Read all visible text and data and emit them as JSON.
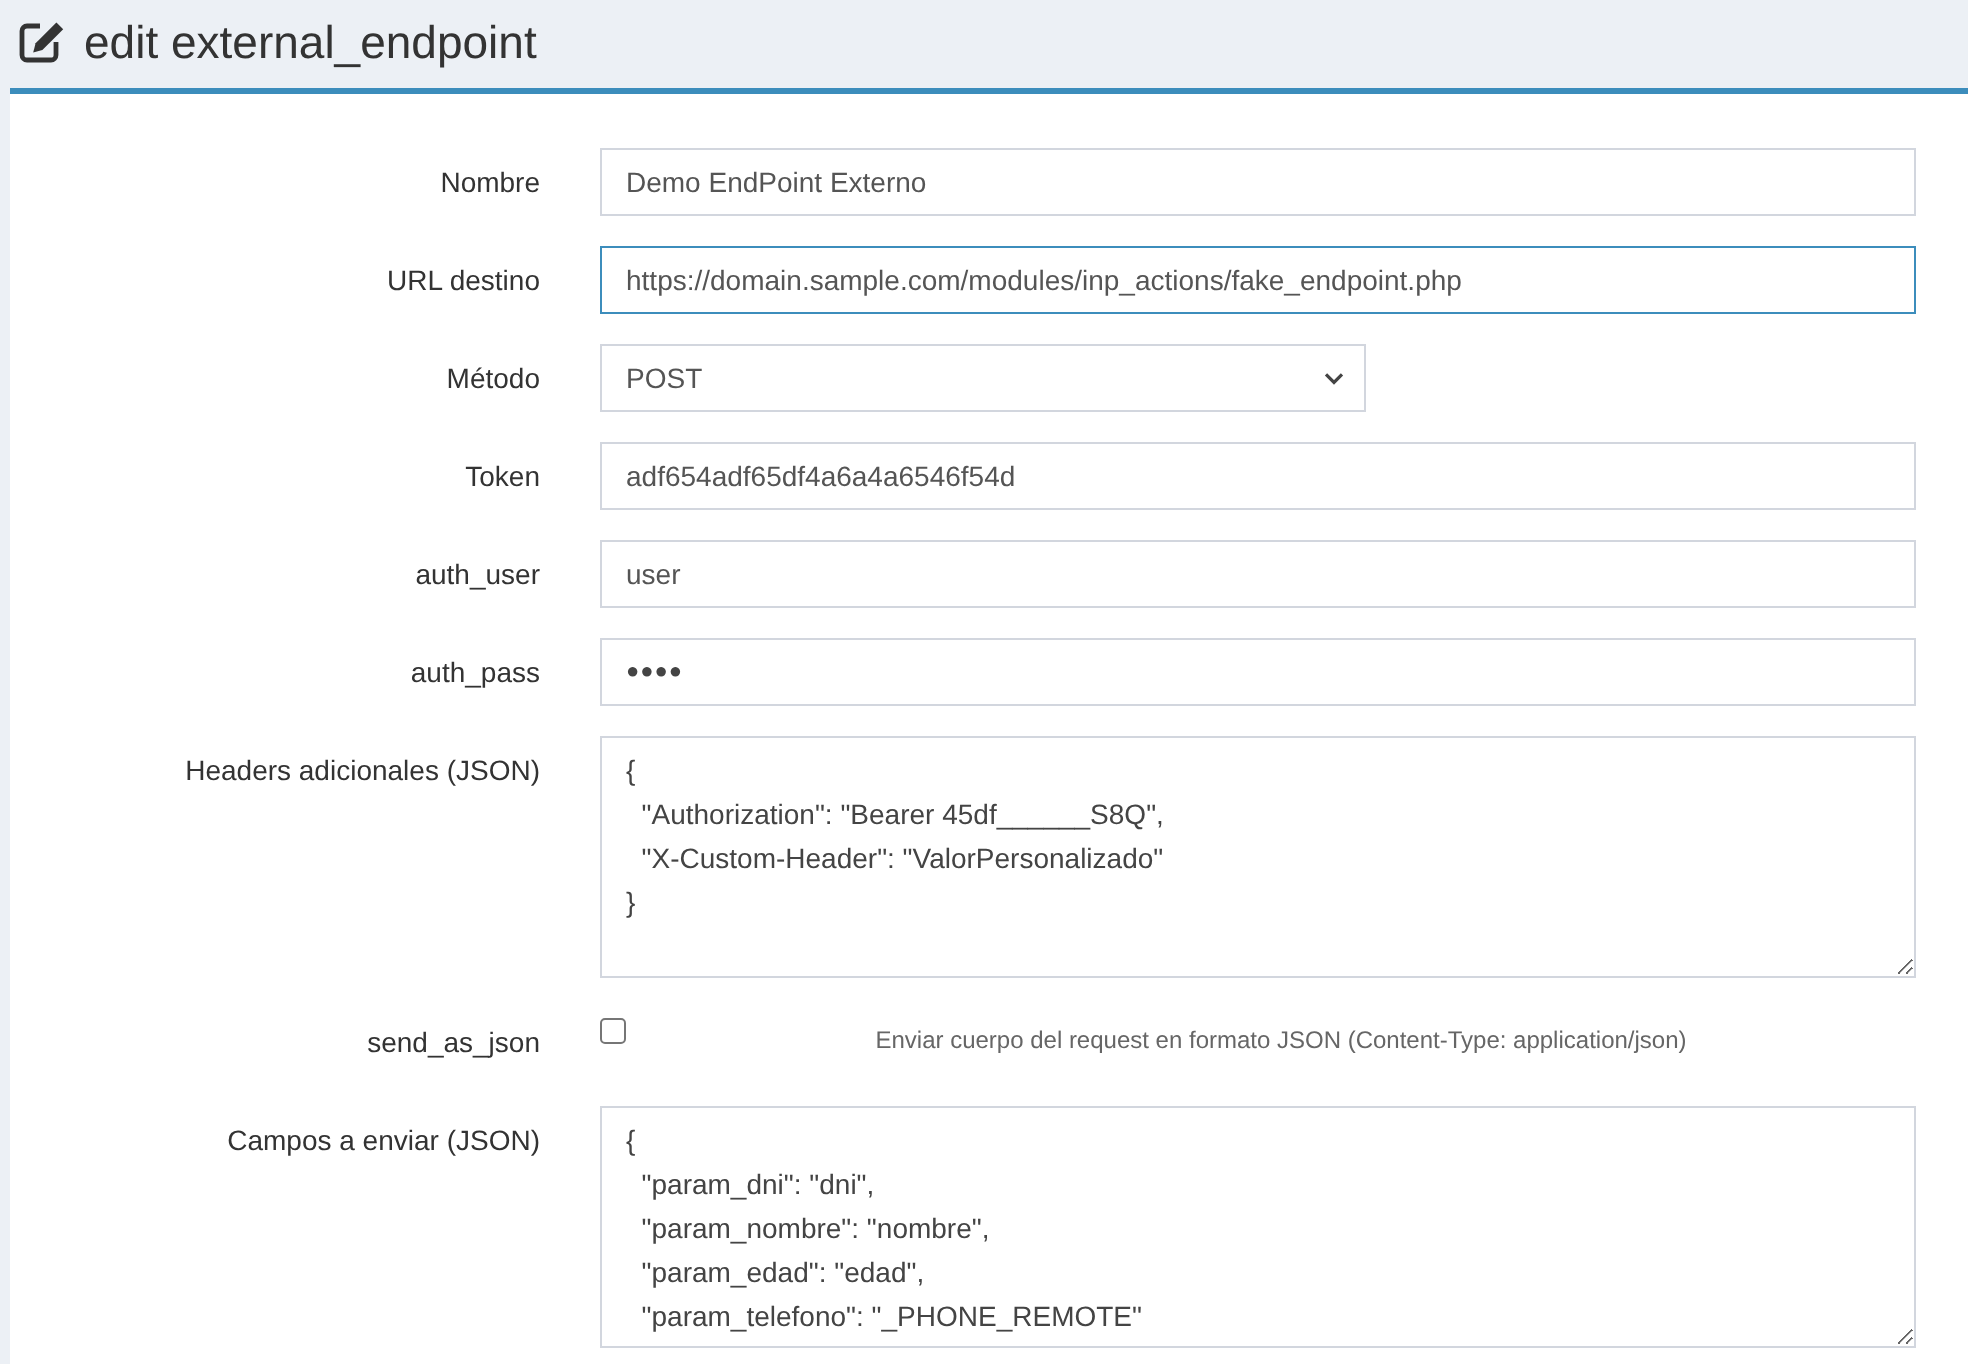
{
  "page": {
    "title": "edit external_endpoint"
  },
  "form": {
    "fields": [
      {
        "kind": "text",
        "label": "Nombre",
        "value": "Demo EndPoint Externo",
        "focused": false
      },
      {
        "kind": "text",
        "label": "URL destino",
        "value": "https://domain.sample.com/modules/inp_actions/fake_endpoint.php",
        "focused": true
      },
      {
        "kind": "select",
        "label": "Método",
        "value": "POST",
        "focused": false
      },
      {
        "kind": "text",
        "label": "Token",
        "value": "adf654adf65df4a6a4a6546f54d",
        "focused": false
      },
      {
        "kind": "text",
        "label": "auth_user",
        "value": "user",
        "focused": false
      },
      {
        "kind": "password",
        "label": "auth_pass",
        "value": "●●●●",
        "focused": false
      },
      {
        "kind": "textarea",
        "label": "Headers adicionales (JSON)",
        "value": "{\n  \"Authorization\": \"Bearer 45df______S8Q\",\n  \"X-Custom-Header\": \"ValorPersonalizado\"\n}",
        "focused": false
      },
      {
        "kind": "checkbox",
        "label": "send_as_json",
        "checked": false,
        "help": "Enviar cuerpo del request en formato JSON (Content-Type: application/json)",
        "focused": false
      },
      {
        "kind": "textarea",
        "label": "Campos a enviar (JSON)",
        "value": "{\n  \"param_dni\": \"dni\",\n  \"param_nombre\": \"nombre\",\n  \"param_edad\": \"edad\",\n  \"param_telefono\": \"_PHONE_REMOTE\"",
        "focused": false
      }
    ]
  }
}
